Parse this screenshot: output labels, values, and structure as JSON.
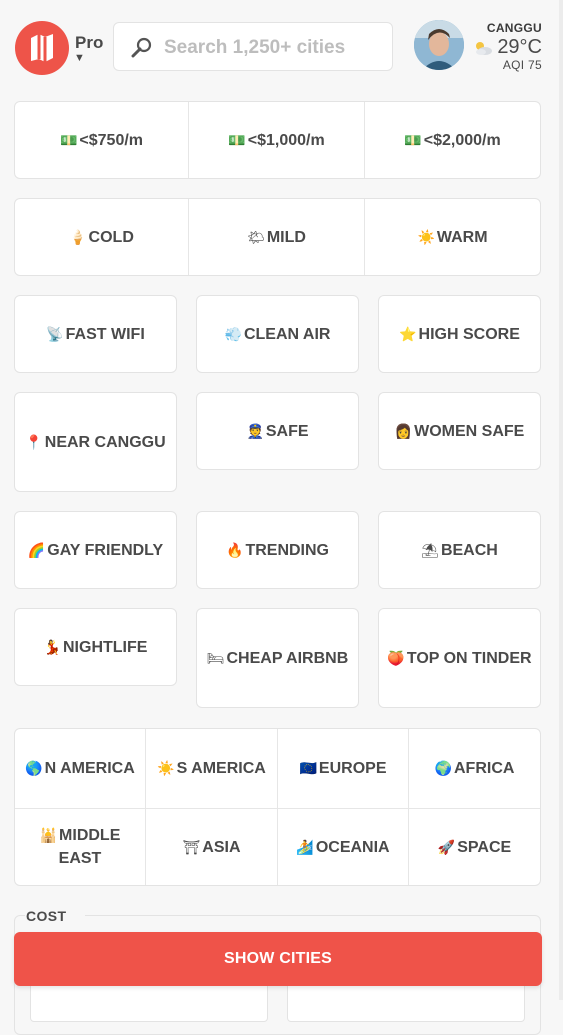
{
  "header": {
    "pro_label": "Pro",
    "search_placeholder": "Search 1,250+ cities",
    "location": "CANGGU",
    "temperature": "29°C",
    "aqi": "AQI 75",
    "brand_color": "#ef5349"
  },
  "filters": {
    "budget": [
      {
        "emoji": "💵",
        "label": "<$750/m"
      },
      {
        "emoji": "💵",
        "label": "<$1,000/m"
      },
      {
        "emoji": "💵",
        "label": "<$2,000/m"
      }
    ],
    "climate": [
      {
        "emoji": "🍦",
        "label": "COLD"
      },
      {
        "emoji": "🌤",
        "label": "MILD"
      },
      {
        "emoji": "☀️",
        "label": "WARM"
      }
    ],
    "row_quality": [
      {
        "emoji": "📡",
        "label": "FAST WIFI"
      },
      {
        "emoji": "💨",
        "label": "CLEAN AIR"
      },
      {
        "emoji": "⭐",
        "label": "HIGH SCORE"
      }
    ],
    "row_safety": [
      {
        "emoji": "📍",
        "label": "NEAR CANGGU"
      },
      {
        "emoji": "👮",
        "label": "SAFE"
      },
      {
        "emoji": "👩",
        "label": "WOMEN SAFE"
      }
    ],
    "row_social": [
      {
        "emoji": "🌈",
        "label": "GAY FRIENDLY"
      },
      {
        "emoji": "🔥",
        "label": "TRENDING"
      },
      {
        "emoji": "⛱",
        "label": "BEACH"
      }
    ],
    "row_fun": [
      {
        "emoji": "💃",
        "label": "NIGHTLIFE"
      },
      {
        "emoji": "🛏",
        "label": "CHEAP AIRBNB"
      },
      {
        "emoji": "🍑",
        "label": "TOP ON TINDER"
      }
    ],
    "regions": [
      {
        "emoji": "🌎",
        "label": "N AMERICA"
      },
      {
        "emoji": "☀️",
        "label": "S AMERICA"
      },
      {
        "emoji": "🇪🇺",
        "label": "EUROPE"
      },
      {
        "emoji": "🌍",
        "label": "AFRICA"
      },
      {
        "emoji": "🕌",
        "label": "MIDDLE EAST"
      },
      {
        "emoji": "⛩",
        "label": "ASIA"
      },
      {
        "emoji": "🏄",
        "label": "OCEANIA"
      },
      {
        "emoji": "🚀",
        "label": "SPACE"
      }
    ]
  },
  "cost_section": {
    "title": "COST"
  },
  "cta": {
    "label": "SHOW CITIES"
  }
}
